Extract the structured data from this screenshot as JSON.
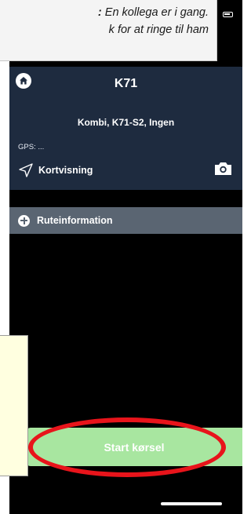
{
  "app": {
    "vehicle_title": "K71",
    "vehicle_subtitle": "Kombi, K71-S2, Ingen",
    "gps_label": "GPS: ...",
    "map_view_label": "Kortvisning",
    "route_info_label": "Ruteinformation",
    "start_button_label": "Start kørsel",
    "icons": {
      "home": "home-icon",
      "navigate": "navigation-arrow-icon",
      "camera": "camera-icon",
      "add": "plus-circle-icon",
      "battery": "battery-icon"
    },
    "colors": {
      "header_bg": "#1e2b3f",
      "route_bar_bg": "#5a6572",
      "start_button_bg": "#a8e6a0",
      "annotation_red": "#e8141b"
    }
  },
  "annotation": {
    "tooltip_line1_prefix": ":",
    "tooltip_line1_text": "En kollega er i gang.",
    "tooltip_line2_text": "k for at ringe til ham"
  }
}
